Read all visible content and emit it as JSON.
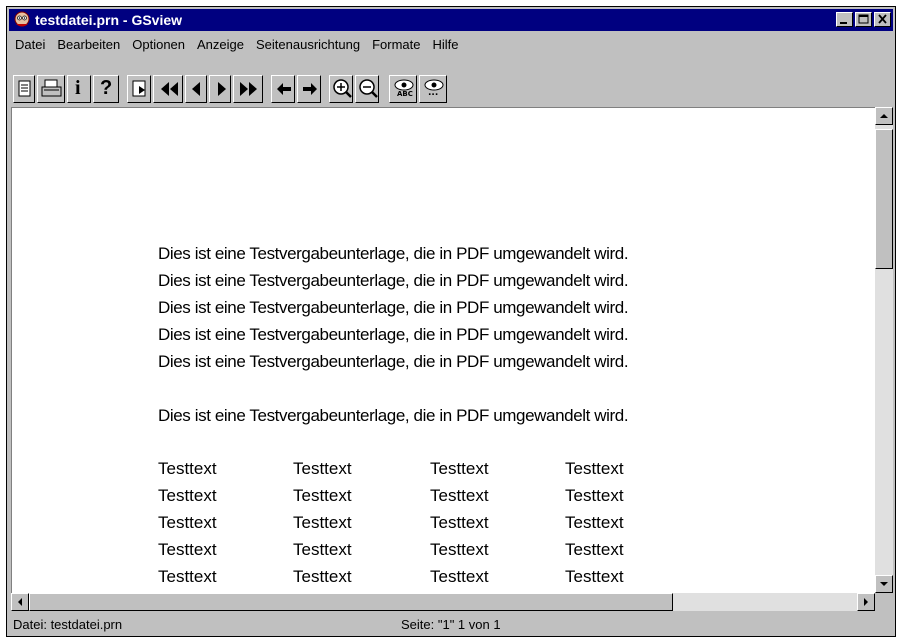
{
  "window": {
    "title": "testdatei.prn - GSview"
  },
  "menu": {
    "items": [
      {
        "label": "Datei"
      },
      {
        "label": "Bearbeiten"
      },
      {
        "label": "Optionen"
      },
      {
        "label": "Anzeige"
      },
      {
        "label": "Seitenausrichtung"
      },
      {
        "label": "Formate"
      },
      {
        "label": "Hilfe"
      }
    ]
  },
  "toolbar": {
    "buttons": [
      {
        "icon": "open-file-icon"
      },
      {
        "icon": "print-icon"
      },
      {
        "icon": "info-icon"
      },
      {
        "icon": "help-icon"
      },
      {
        "icon": "goto-page-icon"
      },
      {
        "icon": "first-page-icon"
      },
      {
        "icon": "previous-page-icon"
      },
      {
        "icon": "next-page-icon"
      },
      {
        "icon": "last-page-icon"
      },
      {
        "icon": "back-icon"
      },
      {
        "icon": "forward-icon"
      },
      {
        "icon": "zoom-in-icon"
      },
      {
        "icon": "zoom-out-icon"
      },
      {
        "icon": "find-text-icon"
      },
      {
        "icon": "find-next-icon"
      }
    ],
    "labels": {
      "info": "i",
      "help": "?",
      "find_text_caption": "ABC",
      "find_next_caption": "..."
    }
  },
  "document": {
    "lines": [
      "Dies ist eine Testvergabeunterlage, die in PDF umgewandelt wird.",
      "Dies ist eine Testvergabeunterlage, die in PDF umgewandelt wird.",
      "Dies ist eine Testvergabeunterlage, die in PDF umgewandelt wird.",
      "Dies ist eine Testvergabeunterlage, die in PDF umgewandelt wird.",
      "Dies ist eine Testvergabeunterlage, die in PDF umgewandelt wird.",
      "Dies ist eine Testvergabeunterlage, die in PDF umgewandelt wird."
    ],
    "table": [
      [
        "Testtext",
        "Testtext",
        "Testtext",
        "Testtext"
      ],
      [
        "Testtext",
        "Testtext",
        "Testtext",
        "Testtext"
      ],
      [
        "Testtext",
        "Testtext",
        "Testtext",
        "Testtext"
      ],
      [
        "Testtext",
        "Testtext",
        "Testtext",
        "Testtext"
      ],
      [
        "Testtext",
        "Testtext",
        "Testtext",
        "Testtext"
      ]
    ]
  },
  "status": {
    "file": "Datei: testdatei.prn",
    "page": "Seite: \"1\"  1 von 1"
  },
  "colors": {
    "titlebar": "#000080",
    "face": "#c0c0c0",
    "page": "#ffffff"
  }
}
